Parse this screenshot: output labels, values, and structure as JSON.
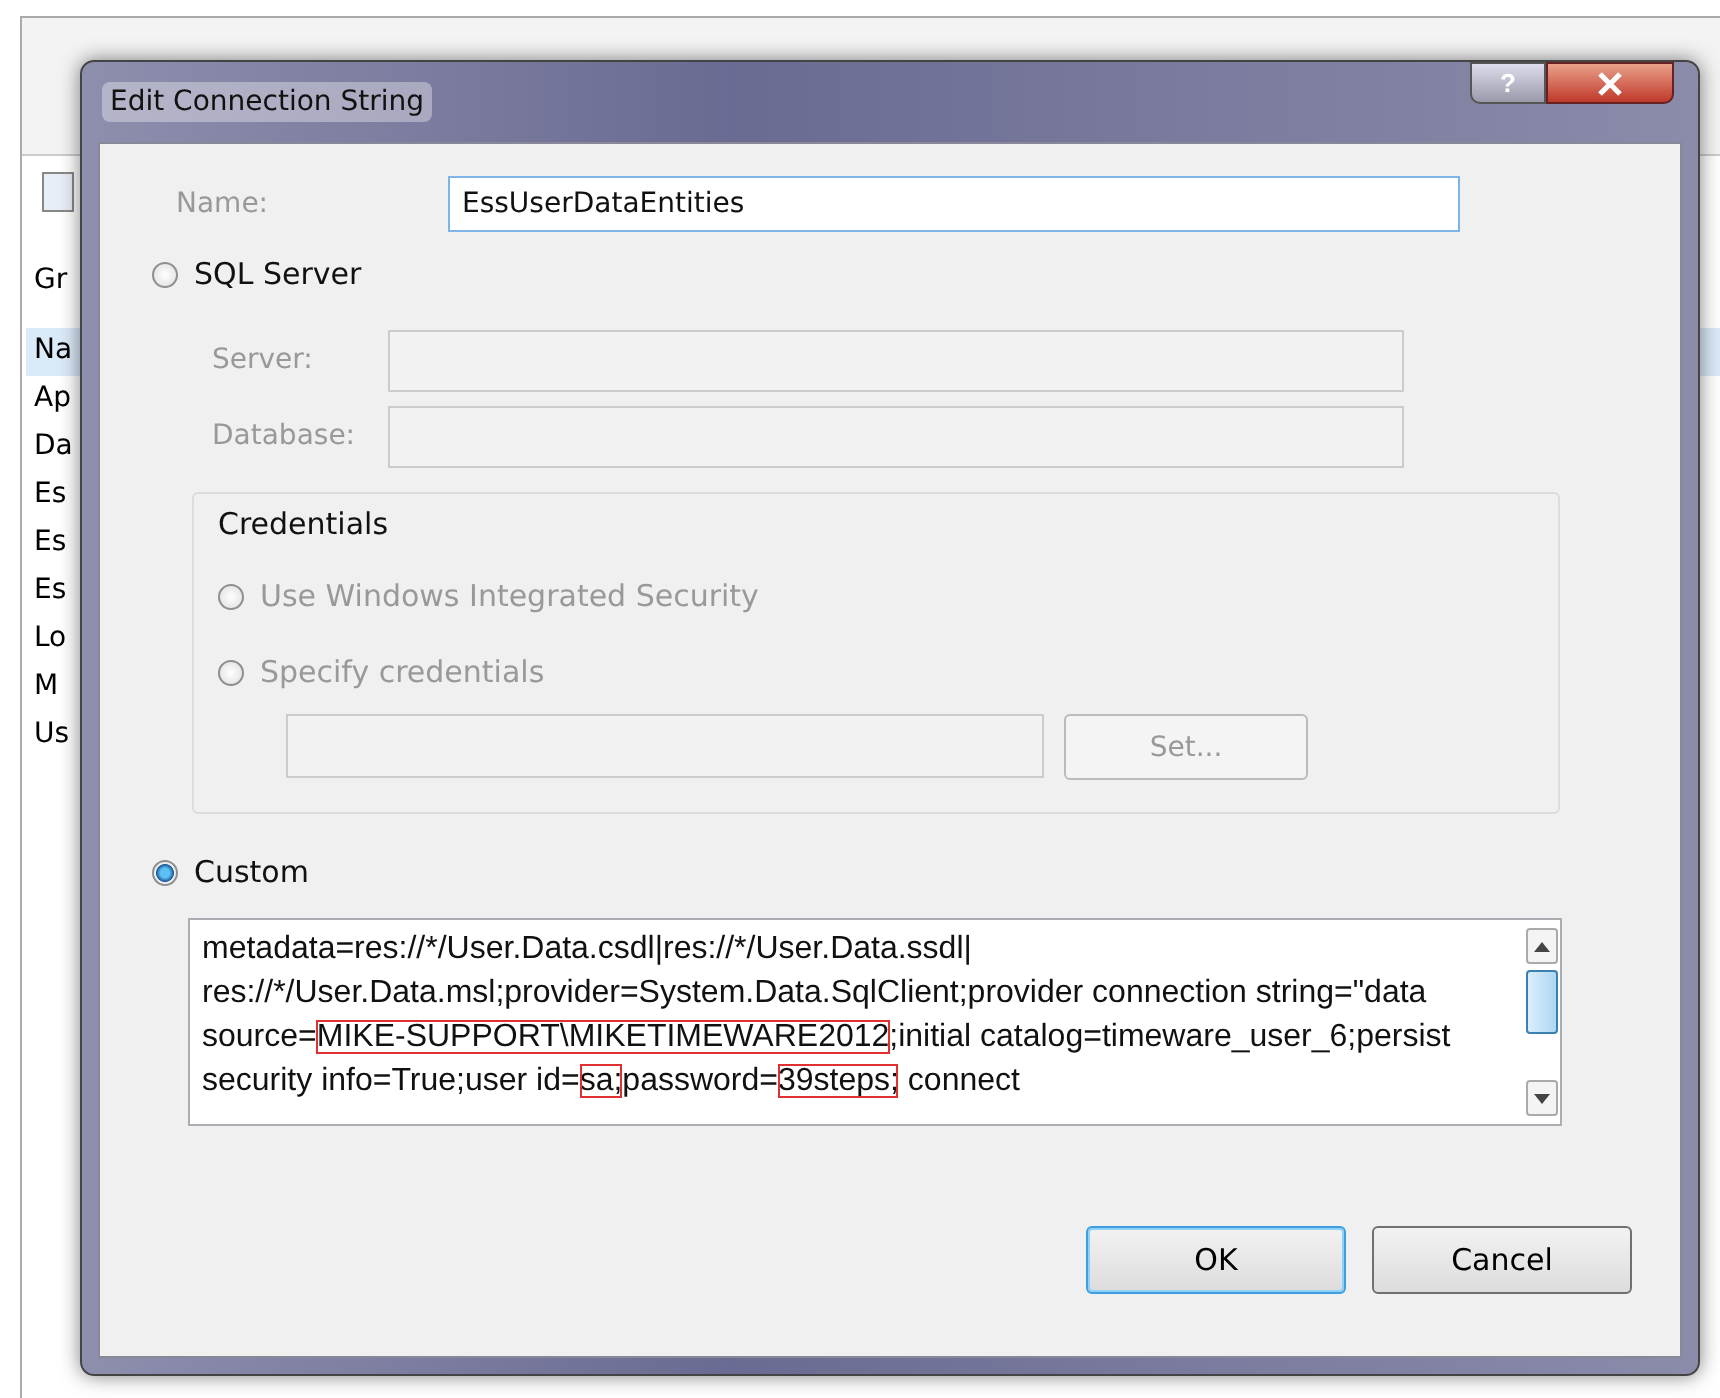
{
  "background_window": {
    "tab": "Gr",
    "items": [
      {
        "label": "Na",
        "selected": true
      },
      {
        "label": "Ap",
        "selected": false
      },
      {
        "label": "Da",
        "selected": false
      },
      {
        "label": "Es",
        "selected": false
      },
      {
        "label": "Es",
        "selected": false
      },
      {
        "label": "Es",
        "selected": false
      },
      {
        "label": "Lo",
        "selected": false
      },
      {
        "label": "M",
        "selected": false
      },
      {
        "label": "Us",
        "selected": false
      }
    ]
  },
  "dialog": {
    "title": "Edit Connection String",
    "help_button": "?"
  },
  "name_field": {
    "label": "Name:",
    "value": "EssUserDataEntities"
  },
  "sql_server": {
    "label": "SQL Server",
    "selected": false,
    "disabled": true,
    "server": {
      "label": "Server:"
    },
    "database": {
      "label": "Database:"
    },
    "credentials": {
      "title": "Credentials",
      "options": [
        {
          "label": "Use Windows Integrated Security",
          "selected": false
        },
        {
          "label": "Specify credentials",
          "selected": false
        }
      ],
      "set_button": "Set..."
    }
  },
  "custom": {
    "label": "Custom",
    "selected": true,
    "segments": [
      {
        "text": "metadata=res://*/User.Data.csdl|res://*/User.Data.ssdl| res://*/User.Data.msl;provider=System.Data.SqlClient;provider connection string=\"data source=",
        "highlighted": false
      },
      {
        "text": "MIKE-SUPPORT\\MIKETIMEWARE2012",
        "highlighted": true
      },
      {
        "text": ";initial catalog=timeware_user_6;persist security info=True;user id=",
        "highlighted": false
      },
      {
        "text": "sa;",
        "highlighted": true
      },
      {
        "text": "password=",
        "highlighted": false
      },
      {
        "text": "39steps;",
        "highlighted": true
      },
      {
        "text": " connect",
        "highlighted": false
      }
    ]
  },
  "buttons": [
    {
      "label": "OK",
      "default": true
    },
    {
      "label": "Cancel",
      "default": false
    }
  ]
}
